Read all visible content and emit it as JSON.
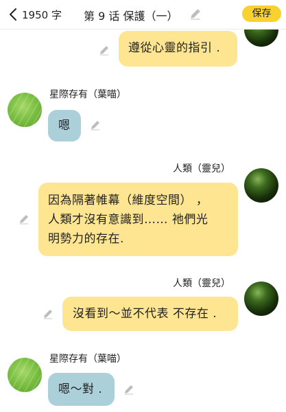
{
  "header": {
    "word_count": "1950 字",
    "chapter_title": "第 9 话  保護（一）",
    "save_label": "保存"
  },
  "messages": [
    {
      "side": "right",
      "sender": "",
      "text": "遵從心靈的指引 ."
    },
    {
      "side": "left",
      "sender": "星際存有（葉喵）",
      "text": "嗯"
    },
    {
      "side": "right",
      "sender": "人類（靈兒）",
      "lines": [
        "因為隔著帷幕（維度空間）  ，",
        "人類才沒有意識到…… 祂們光",
        "明勢力的存在."
      ]
    },
    {
      "side": "right",
      "sender": "人類（靈兒）",
      "text": "沒看到～並不代表 不存在 ."
    },
    {
      "side": "left",
      "sender": "星際存有（葉喵）",
      "text": "嗯～對 ."
    }
  ],
  "colors": {
    "accent_yellow": "#f9d230",
    "bubble_right": "#fde592",
    "bubble_left": "#abd0da"
  },
  "icons": [
    "chevron-left-icon",
    "pencil-icon"
  ]
}
